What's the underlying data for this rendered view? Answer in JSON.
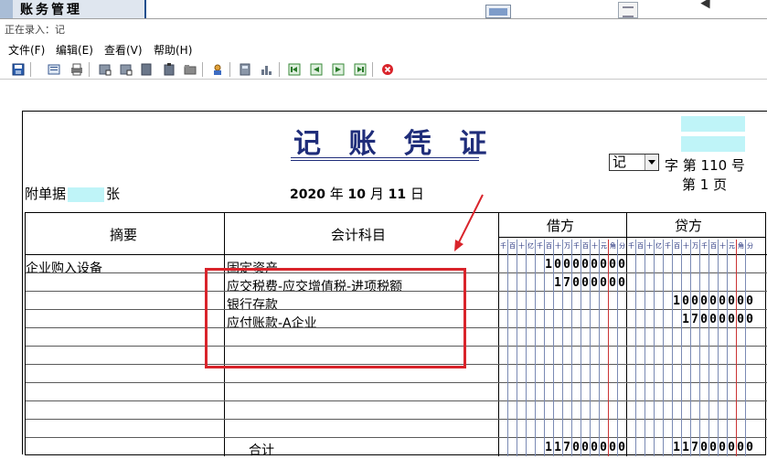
{
  "background_app": {
    "title": "账务管理"
  },
  "window": {
    "status": "正在录入：记"
  },
  "menu": {
    "items": [
      "文件(F)",
      "编辑(E)",
      "查看(V)",
      "帮助(H)"
    ]
  },
  "toolbar": {
    "icons": [
      "save-icon",
      "preview-icon",
      "print-icon",
      "insert-row-icon",
      "delete-row-icon",
      "copy-icon",
      "paste-icon",
      "folder-icon",
      "user-icon",
      "calculator-icon",
      "chart-icon",
      "first-icon",
      "prev-icon",
      "next-icon",
      "last-icon",
      "close-icon"
    ]
  },
  "voucher": {
    "title": "记 账 凭 证",
    "type_value": "记",
    "number_text": "字 第 110 号",
    "page_text": "第  1  页",
    "attach_prefix": "附单据",
    "attach_suffix": "张",
    "year": "2020",
    "year_unit": "年",
    "month": "10",
    "month_unit": "月",
    "day": "11",
    "day_unit": "日",
    "headers": {
      "summary": "摘要",
      "account": "会计科目",
      "debit": "借方",
      "credit": "贷方",
      "digits": [
        "千",
        "百",
        "十",
        "亿",
        "千",
        "百",
        "十",
        "万",
        "千",
        "百",
        "十",
        "元",
        "角",
        "分"
      ]
    },
    "rows": [
      {
        "summary": "企业购入设备",
        "account": "固定资产",
        "debit": "100000000",
        "credit": ""
      },
      {
        "summary": "",
        "account": "应交税费-应交增值税-进项税额",
        "debit": "17000000",
        "credit": ""
      },
      {
        "summary": "",
        "account": "银行存款",
        "debit": "",
        "credit": "100000000"
      },
      {
        "summary": "",
        "account": "应付账款-A企业",
        "debit": "",
        "credit": "17000000"
      }
    ],
    "total_label": "合计",
    "total_debit": "117000000",
    "total_credit": "117000000"
  },
  "annotation": {
    "color": "#d9242b"
  },
  "colors": {
    "title_blue": "#1f2d7a",
    "highlight_cyan": "#bff4f8"
  }
}
